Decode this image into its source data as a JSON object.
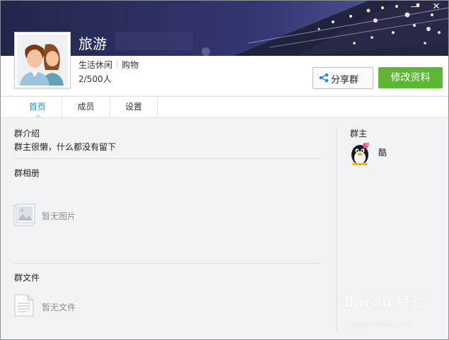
{
  "window": {
    "minimize_glyph": "—",
    "close_glyph": "✕"
  },
  "group": {
    "name": "旅游",
    "tags": [
      "生活休闲",
      "购物"
    ],
    "members": "2/500人"
  },
  "actions": {
    "share_label": "分享群",
    "edit_label": "修改资料"
  },
  "tabs": [
    {
      "label": "首页",
      "active": true
    },
    {
      "label": "成员",
      "active": false
    },
    {
      "label": "设置",
      "active": false
    }
  ],
  "intro": {
    "title": "群介绍",
    "text": "群主很懒，什么都没有留下"
  },
  "album": {
    "title": "群相册",
    "empty_label": "暂无图片",
    "icon": "image-icon"
  },
  "files": {
    "title": "群文件",
    "empty_label": "暂无文件",
    "icon": "file-icon"
  },
  "owner": {
    "title": "群主",
    "name": "酷",
    "avatar_icon": "penguin-avatar-icon"
  },
  "watermark": {
    "brand": "Bai du 经验",
    "url": "jingyan.baidu.com"
  },
  "colors": {
    "accent_green": "#5fb534",
    "active_tab_blue": "#1e8fd6",
    "banner_dark": "#2b2f5a"
  }
}
